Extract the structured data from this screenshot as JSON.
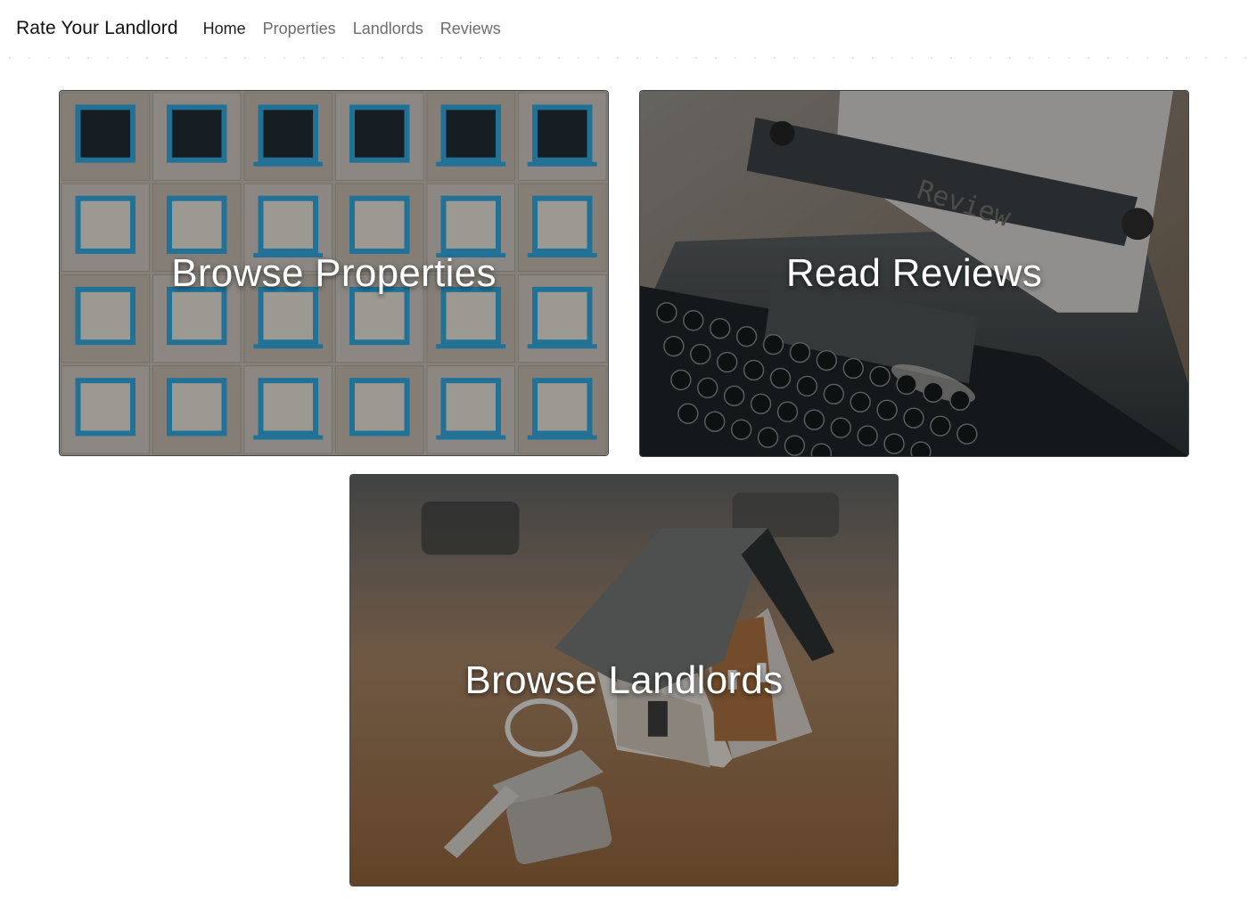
{
  "navbar": {
    "brand": "Rate Your Landlord",
    "links": [
      {
        "label": "Home",
        "active": true
      },
      {
        "label": "Properties",
        "active": false
      },
      {
        "label": "Landlords",
        "active": false
      },
      {
        "label": "Reviews",
        "active": false
      }
    ]
  },
  "cards": [
    {
      "label": "Browse Properties",
      "image_icon": "apartment-building-photo"
    },
    {
      "label": "Read Reviews",
      "image_icon": "typewriter-review-photo"
    },
    {
      "label": "Browse Landlords",
      "image_icon": "house-keys-photo"
    }
  ],
  "colors": {
    "window_trim": "#2f9fd0",
    "wall": "#bdb5ad",
    "wood": "#8a5c36"
  }
}
